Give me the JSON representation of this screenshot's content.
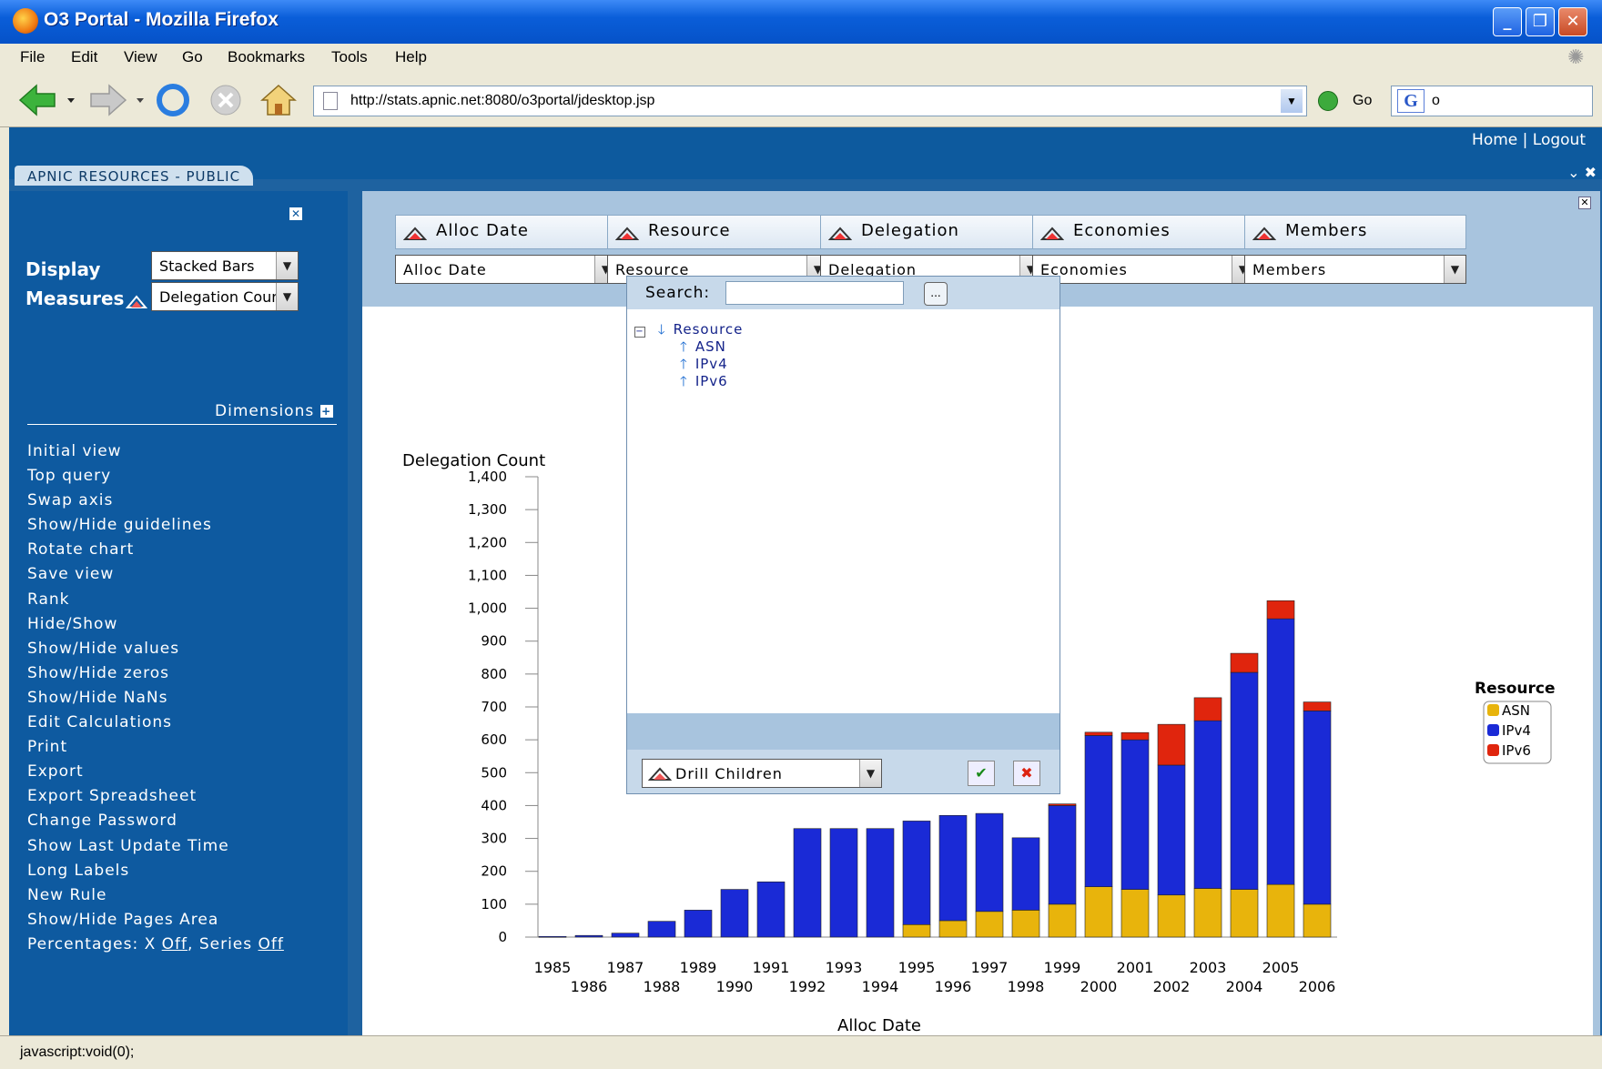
{
  "window": {
    "title": "O3 Portal - Mozilla Firefox"
  },
  "menu": [
    "File",
    "Edit",
    "View",
    "Go",
    "Bookmarks",
    "Tools",
    "Help"
  ],
  "nav": {
    "url": "http://stats.apnic.net:8080/o3portal/jdesktop.jsp",
    "go_label": "Go",
    "search_value": "o"
  },
  "header": {
    "home": "Home",
    "sep": "|",
    "logout": "Logout",
    "tab": "APNIC RESOURCES - PUBLIC"
  },
  "sidebar": {
    "display_label": "Display",
    "display_value": "Stacked Bars",
    "measures_label": "Measures",
    "measures_value": "Delegation Count",
    "dimensions_link": "Dimensions",
    "items": [
      "Initial view",
      "Top query",
      "Swap axis",
      "Show/Hide guidelines",
      "Rotate chart",
      "Save view",
      "Rank",
      "Hide/Show",
      "Show/Hide values",
      "Show/Hide zeros",
      "Show/Hide NaNs",
      "Edit Calculations",
      "Print",
      "Export",
      "Export Spreadsheet",
      "Change Password",
      "Show Last Update Time",
      "Long Labels",
      "New Rule",
      "Show/Hide Pages Area"
    ],
    "percentages": {
      "prefix": "Percentages: X ",
      "x_value": "Off",
      "mid": ", Series ",
      "series_value": "Off"
    }
  },
  "dimensions": [
    {
      "button": "Alloc Date",
      "select": "Alloc Date"
    },
    {
      "button": "Resource",
      "select": "Resource"
    },
    {
      "button": "Delegation",
      "select": "Delegation"
    },
    {
      "button": "Economies",
      "select": "Economies"
    },
    {
      "button": "Members",
      "select": "Members"
    }
  ],
  "popup": {
    "search_label": "Search:",
    "search_value": "",
    "dots": "...",
    "tree_root": "Resource",
    "tree_children": [
      "ASN",
      "IPv4",
      "IPv6"
    ],
    "action": "Drill Children"
  },
  "status": {
    "text": "javascript:void(0);"
  },
  "chart_data": {
    "type": "bar",
    "stacked": true,
    "xlabel": "Alloc Date",
    "ylabel": "Delegation Count",
    "ylim": [
      0,
      1400
    ],
    "yticks": [
      0,
      100,
      200,
      300,
      400,
      500,
      600,
      700,
      800,
      900,
      1000,
      1100,
      1200,
      1300,
      1400
    ],
    "categories": [
      "1985",
      "1986",
      "1987",
      "1988",
      "1989",
      "1990",
      "1991",
      "1992",
      "1993",
      "1994",
      "1995",
      "1996",
      "1997",
      "1998",
      "1999",
      "2000",
      "2001",
      "2002",
      "2003",
      "2004",
      "2005",
      "2006"
    ],
    "series": [
      {
        "name": "ASN",
        "color": "#e8b40c",
        "values": [
          0,
          0,
          0,
          0,
          0,
          0,
          0,
          0,
          0,
          0,
          38,
          50,
          78,
          82,
          100,
          153,
          145,
          128,
          148,
          145,
          160,
          100
        ]
      },
      {
        "name": "IPv4",
        "color": "#1a2ad6",
        "values": [
          2,
          5,
          12,
          48,
          82,
          145,
          168,
          330,
          330,
          330,
          315,
          320,
          298,
          220,
          300,
          460,
          455,
          395,
          510,
          660,
          808,
          588
        ]
      },
      {
        "name": "IPv6",
        "color": "#e0250d",
        "values": [
          0,
          0,
          0,
          0,
          0,
          0,
          0,
          0,
          0,
          0,
          0,
          0,
          0,
          0,
          5,
          10,
          22,
          124,
          70,
          58,
          55,
          27
        ]
      }
    ],
    "legend_title": "Resource",
    "legend_position": "right",
    "grid": false
  }
}
